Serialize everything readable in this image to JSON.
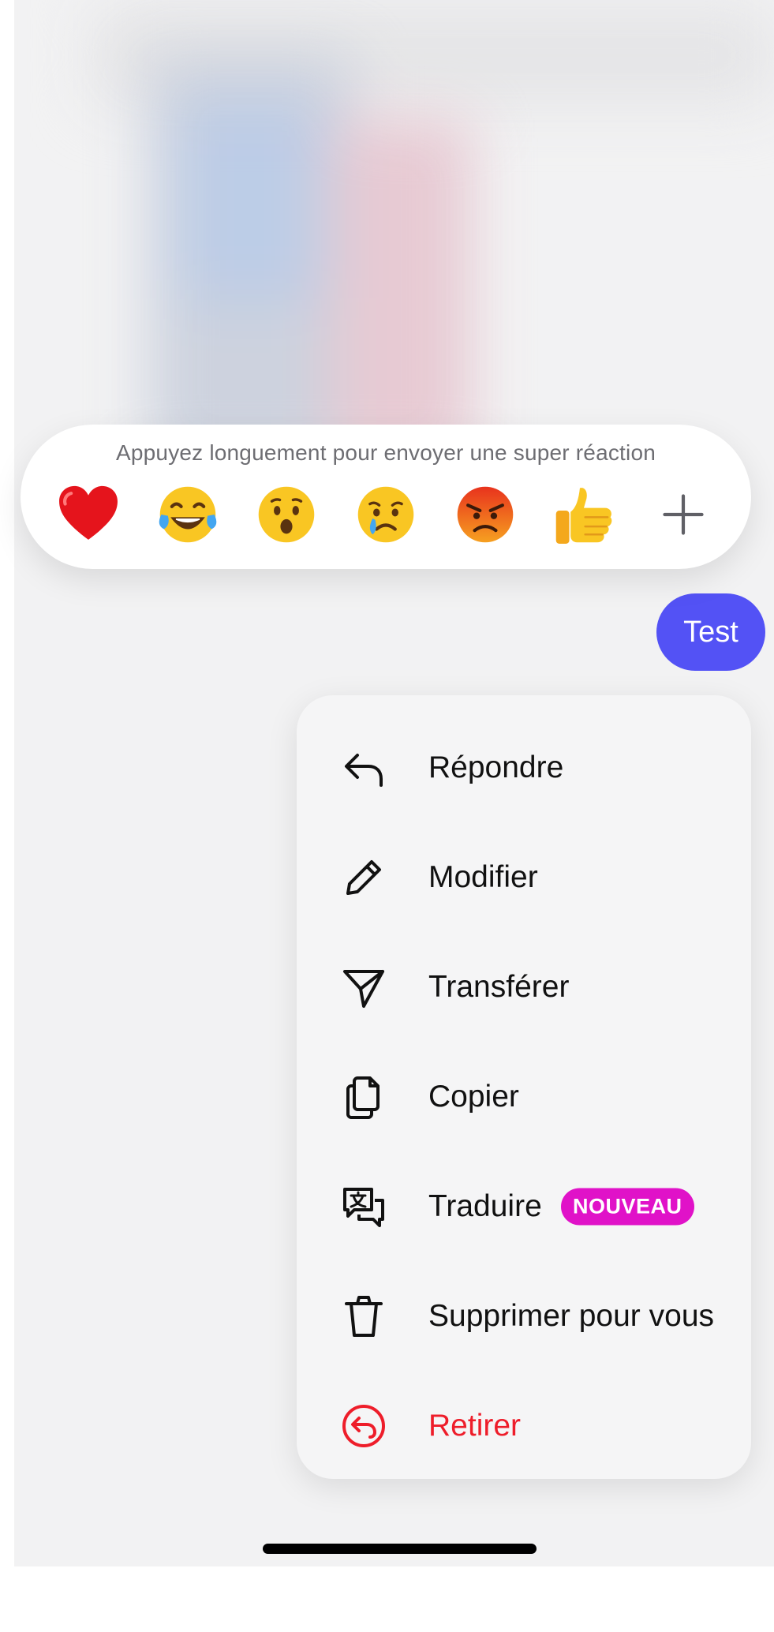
{
  "reactions": {
    "hint": "Appuyez longuement pour envoyer une super réaction",
    "emojis": [
      {
        "icon": "red-heart-icon"
      },
      {
        "icon": "tears-of-joy-icon"
      },
      {
        "icon": "surprised-face-icon"
      },
      {
        "icon": "crying-face-icon"
      },
      {
        "icon": "angry-face-icon"
      },
      {
        "icon": "thumbs-up-icon"
      },
      {
        "icon": "plus-icon"
      }
    ]
  },
  "message": {
    "text": "Test",
    "bubble_color": "#5352f5"
  },
  "menu": {
    "items": [
      {
        "label": "Répondre",
        "icon": "reply-icon"
      },
      {
        "label": "Modifier",
        "icon": "pencil-icon"
      },
      {
        "label": "Transférer",
        "icon": "send-icon"
      },
      {
        "label": "Copier",
        "icon": "copy-icon"
      },
      {
        "label": "Traduire",
        "icon": "translate-icon",
        "badge": "NOUVEAU"
      },
      {
        "label": "Supprimer pour vous",
        "icon": "trash-icon"
      },
      {
        "label": "Retirer",
        "icon": "unsend-icon"
      }
    ],
    "danger_color": "#ee1d2a",
    "badge_color": "#e012c8"
  }
}
